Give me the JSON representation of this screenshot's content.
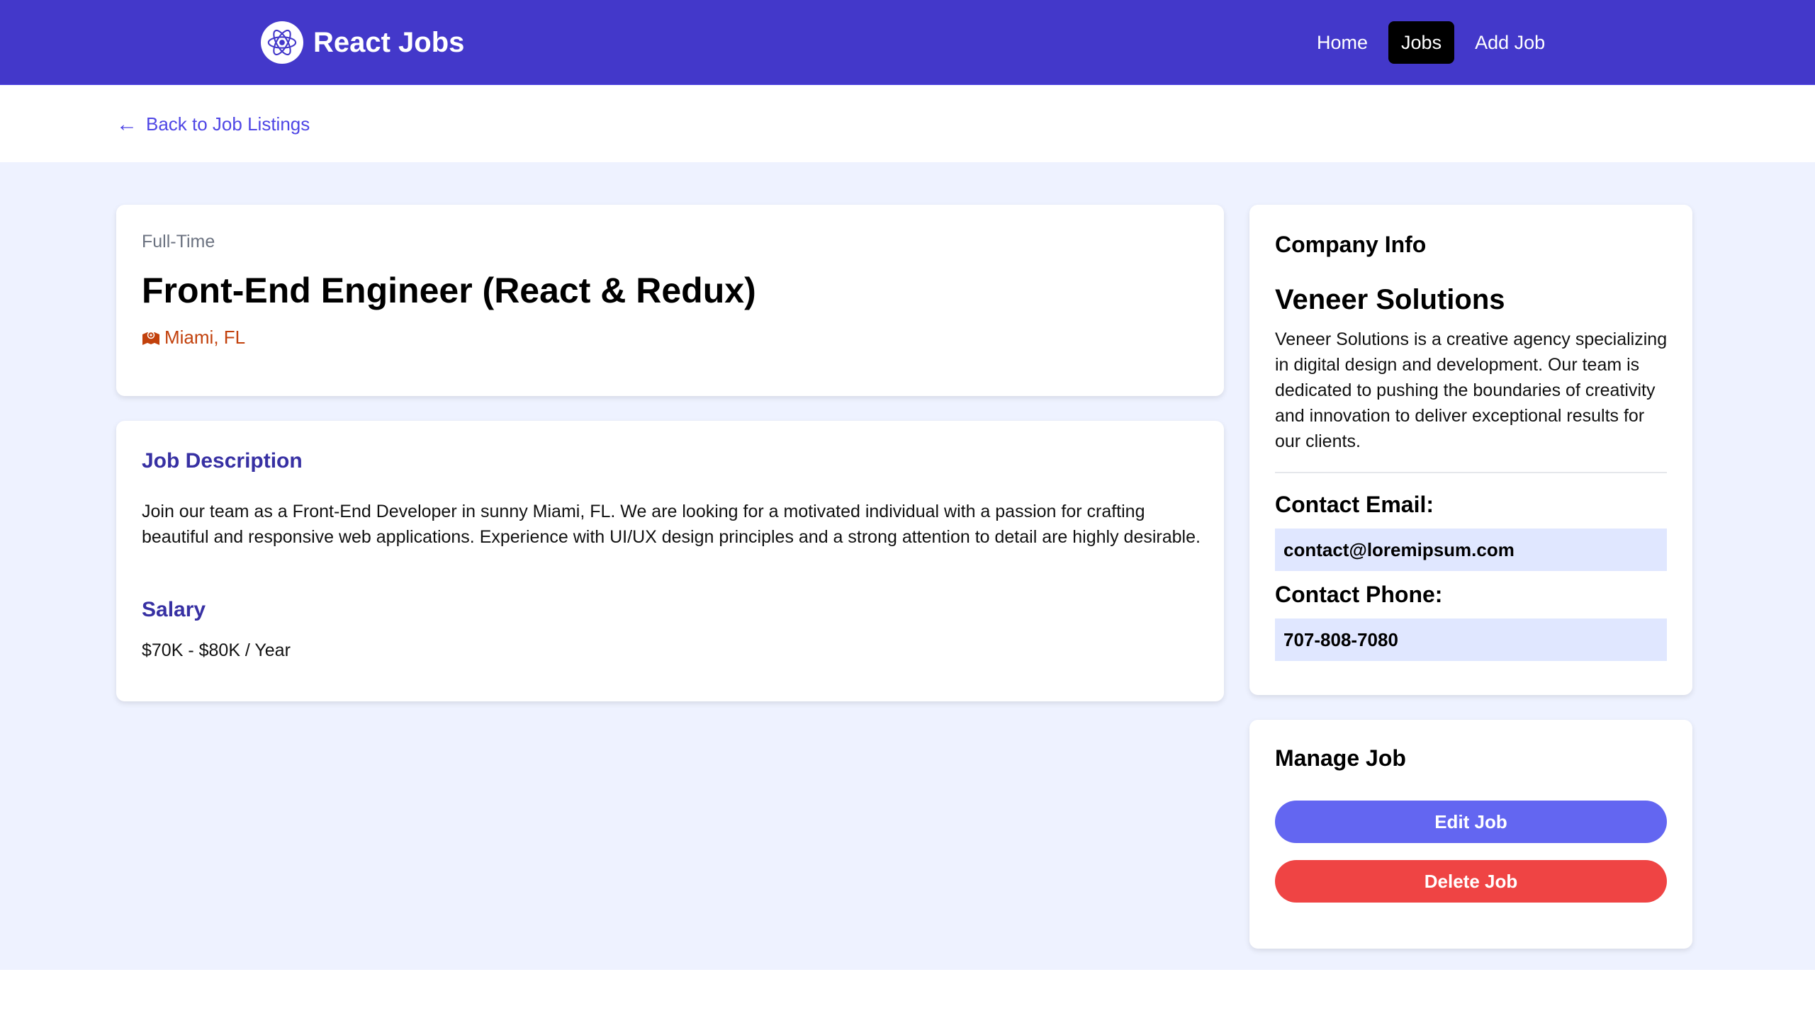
{
  "navbar": {
    "brand": "React Jobs",
    "links": [
      "Home",
      "Jobs",
      "Add Job"
    ],
    "active": "Jobs"
  },
  "back_link": "Back to Job Listings",
  "job": {
    "type": "Full-Time",
    "title": "Front-End Engineer (React & Redux)",
    "location": "Miami, FL",
    "description_heading": "Job Description",
    "description": "Join our team as a Front-End Developer in sunny Miami, FL. We are looking for a motivated individual with a passion for crafting beautiful and responsive web applications. Experience with UI/UX design principles and a strong attention to detail are highly desirable.",
    "salary_heading": "Salary",
    "salary": "$70K - $80K / Year"
  },
  "company": {
    "heading": "Company Info",
    "name": "Veneer Solutions",
    "description": "Veneer Solutions is a creative agency specializing in digital design and development. Our team is dedicated to pushing the boundaries of creativity and innovation to deliver exceptional results for our clients.",
    "email_label": "Contact Email:",
    "email": "contact@loremipsum.com",
    "phone_label": "Contact Phone:",
    "phone": "707-808-7080"
  },
  "manage": {
    "heading": "Manage Job",
    "edit_label": "Edit Job",
    "delete_label": "Delete Job"
  },
  "colors": {
    "navbar": "#4338ca",
    "background": "#eef2ff",
    "accent": "#4f46e5",
    "heading_accent": "#3730a3",
    "location": "#c2410c",
    "edit_button": "#6366f1",
    "delete_button": "#ef4444",
    "contact_box": "#e0e7ff"
  },
  "icons": {
    "brand_logo": "react-atom-icon",
    "back": "arrow-left-icon",
    "location": "map-marker-icon"
  }
}
